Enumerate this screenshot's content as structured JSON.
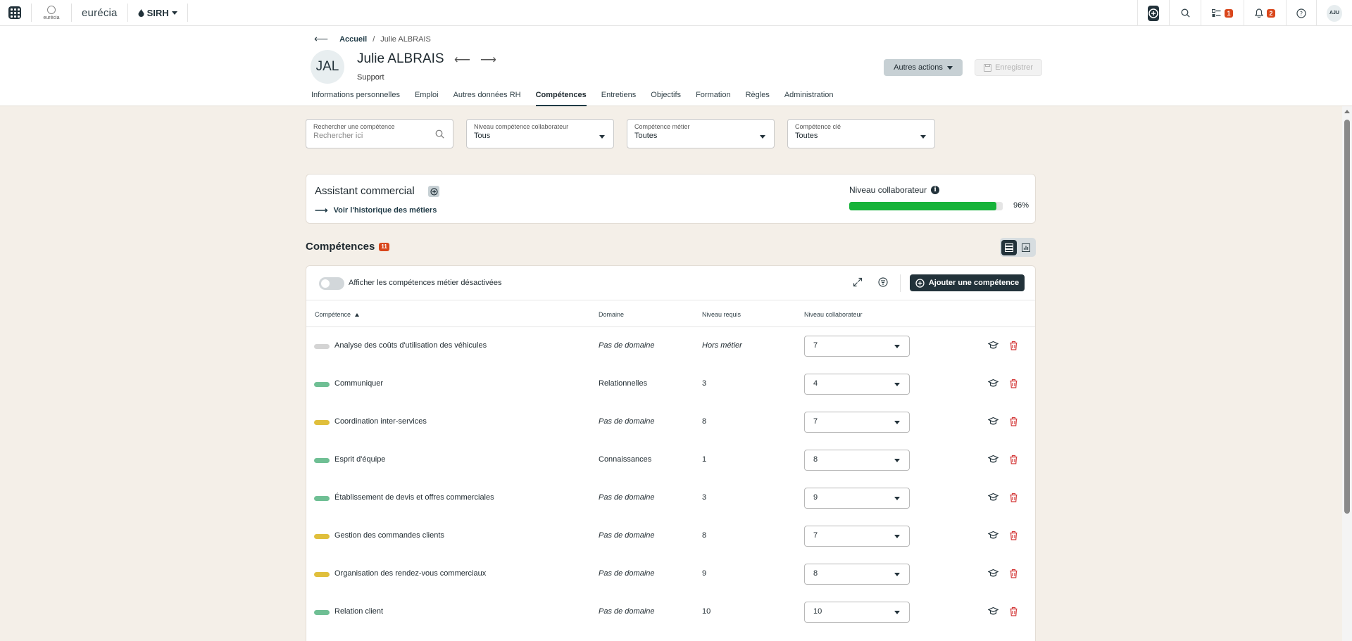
{
  "topbar": {
    "logo_text": "eurécia",
    "brand": "eurécia",
    "module": "SIRH",
    "tasks_badge": "1",
    "notifications_badge": "2",
    "user_initials": "AJU"
  },
  "breadcrumb": {
    "home": "Accueil",
    "sep": "/",
    "current": "Julie ALBRAIS"
  },
  "person": {
    "initials": "JAL",
    "name": "Julie ALBRAIS",
    "role": "Support"
  },
  "actions": {
    "more": "Autres actions",
    "save": "Enregistrer"
  },
  "tabs": [
    {
      "label": "Informations personnelles"
    },
    {
      "label": "Emploi"
    },
    {
      "label": "Autres données RH"
    },
    {
      "label": "Compétences"
    },
    {
      "label": "Entretiens"
    },
    {
      "label": "Objectifs"
    },
    {
      "label": "Formation"
    },
    {
      "label": "Règles"
    },
    {
      "label": "Administration"
    }
  ],
  "active_tab": "Compétences",
  "filters": {
    "search": {
      "label": "Rechercher une compétence",
      "placeholder": "Rechercher ici"
    },
    "level": {
      "label": "Niveau compétence collaborateur",
      "value": "Tous"
    },
    "job_skill": {
      "label": "Compétence métier",
      "value": "Toutes"
    },
    "key_skill": {
      "label": "Compétence clé",
      "value": "Toutes"
    }
  },
  "job": {
    "title": "Assistant commercial",
    "history_link": "Voir l'historique des métiers",
    "level_label": "Niveau collaborateur",
    "level_percent": 96,
    "level_text": "96%"
  },
  "competences": {
    "title": "Compétences",
    "count": "11",
    "toggle_label": "Afficher les compétences métier désactivées",
    "add_button": "Ajouter une compétence",
    "columns": {
      "competence": "Compétence",
      "domain": "Domaine",
      "required": "Niveau requis",
      "collab": "Niveau collaborateur"
    },
    "rows": [
      {
        "name": "Analyse des coûts d'utilisation des véhicules",
        "domain": "Pas de domaine",
        "domain_italic": true,
        "required": "Hors métier",
        "required_italic": true,
        "level": "7",
        "status_color": "#d4d4d4"
      },
      {
        "name": "Communiquer",
        "domain": "Relationnelles",
        "domain_italic": false,
        "required": "3",
        "required_italic": false,
        "level": "4",
        "status_color": "#6fbf94"
      },
      {
        "name": "Coordination inter-services",
        "domain": "Pas de domaine",
        "domain_italic": true,
        "required": "8",
        "required_italic": false,
        "level": "7",
        "status_color": "#e0bf3c"
      },
      {
        "name": "Esprit d'équipe",
        "domain": "Connaissances",
        "domain_italic": false,
        "required": "1",
        "required_italic": false,
        "level": "8",
        "status_color": "#6fbf94"
      },
      {
        "name": "Établissement de devis et offres commerciales",
        "domain": "Pas de domaine",
        "domain_italic": true,
        "required": "3",
        "required_italic": false,
        "level": "9",
        "status_color": "#6fbf94"
      },
      {
        "name": "Gestion des commandes clients",
        "domain": "Pas de domaine",
        "domain_italic": true,
        "required": "8",
        "required_italic": false,
        "level": "7",
        "status_color": "#e0bf3c"
      },
      {
        "name": "Organisation des rendez-vous commerciaux",
        "domain": "Pas de domaine",
        "domain_italic": true,
        "required": "9",
        "required_italic": false,
        "level": "8",
        "status_color": "#e0bf3c"
      },
      {
        "name": "Relation client",
        "domain": "Pas de domaine",
        "domain_italic": true,
        "required": "10",
        "required_italic": false,
        "level": "10",
        "status_color": "#6fbf94"
      }
    ]
  },
  "colors": {
    "primary": "#22323a",
    "progress": "#17b33a",
    "badge": "#d9461b",
    "delete": "#d43b3b",
    "page_bg": "#f4efe8"
  }
}
